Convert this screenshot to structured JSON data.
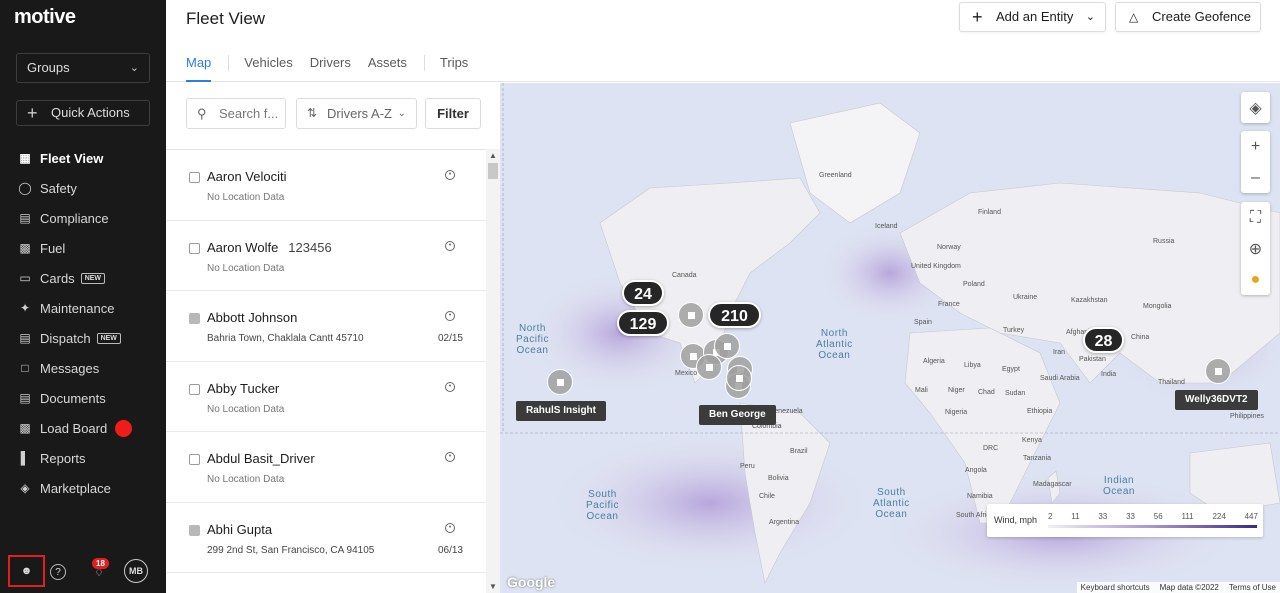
{
  "sidebar": {
    "logo": "motive",
    "groups_label": "Groups",
    "quick_actions_label": "Quick Actions",
    "items": [
      {
        "label": "Fleet View",
        "icon": "map-icon",
        "active": true
      },
      {
        "label": "Safety",
        "icon": "shield-icon"
      },
      {
        "label": "Compliance",
        "icon": "document-icon"
      },
      {
        "label": "Fuel",
        "icon": "fuel-icon"
      },
      {
        "label": "Cards",
        "icon": "card-icon",
        "badge": "NEW"
      },
      {
        "label": "Maintenance",
        "icon": "wrench-icon"
      },
      {
        "label": "Dispatch",
        "icon": "dispatch-icon",
        "badge": "NEW"
      },
      {
        "label": "Messages",
        "icon": "message-icon"
      },
      {
        "label": "Documents",
        "icon": "documents-icon"
      },
      {
        "label": "Load Board",
        "icon": "truck-icon",
        "dot_color": "#ef1c1c"
      },
      {
        "label": "Reports",
        "icon": "reports-icon"
      },
      {
        "label": "Marketplace",
        "icon": "marketplace-icon"
      }
    ],
    "notification_count": "18",
    "avatar_initials": "MB"
  },
  "header": {
    "title": "Fleet View",
    "add_entity_label": "Add an Entity",
    "create_geofence_label": "Create Geofence",
    "tabs": [
      {
        "label": "Map",
        "active": true
      },
      {
        "label": "Vehicles"
      },
      {
        "label": "Drivers"
      },
      {
        "label": "Assets"
      },
      {
        "label": "Trips"
      }
    ]
  },
  "list": {
    "search_placeholder": "Search f...",
    "sort_label": "Drivers A-Z",
    "filter_label": "Filter",
    "drivers": [
      {
        "name": "Aaron Velociti",
        "vehicle": "",
        "location": "No Location Data",
        "date": "",
        "status": "empty"
      },
      {
        "name": "Aaron Wolfe",
        "vehicle": "123456",
        "location": "No Location Data",
        "date": "",
        "status": "empty"
      },
      {
        "name": "Abbott Johnson",
        "vehicle": "",
        "location": "Bahria Town, Chaklala Cantt 45710",
        "date": "02/15",
        "status": "filled"
      },
      {
        "name": "Abby Tucker",
        "vehicle": "",
        "location": "No Location Data",
        "date": "",
        "status": "empty"
      },
      {
        "name": "Abdul Basit_Driver",
        "vehicle": "",
        "location": "No Location Data",
        "date": "",
        "status": "empty"
      },
      {
        "name": "Abhi Gupta",
        "vehicle": "",
        "location": "299 2nd St, San Francisco, CA 94105",
        "date": "06/13",
        "status": "filled"
      }
    ]
  },
  "map": {
    "clusters": [
      "24",
      "129",
      "210",
      "28"
    ],
    "tags": [
      "RahulS Insight",
      "Ben George",
      "Welly36DVT2"
    ],
    "oceans": [
      "North\nPacific\nOcean",
      "North\nAtlantic\nOcean",
      "South\nPacific\nOcean",
      "South\nAtlantic\nOcean",
      "Indian\nOcean"
    ],
    "places": [
      "Greenland",
      "Iceland",
      "Norway",
      "Finland",
      "Russia",
      "Canada",
      "United Kingdom",
      "Poland",
      "Ukraine",
      "Kazakhstan",
      "Mongolia",
      "France",
      "Spain",
      "Turkey",
      "Iran",
      "China",
      "Afghanistan",
      "Pakistan",
      "Algeria",
      "Libya",
      "Egypt",
      "Saudi Arabia",
      "Mali",
      "Niger",
      "Chad",
      "Sudan",
      "Nigeria",
      "Ethiopia",
      "Kenya",
      "DRC",
      "Tanzania",
      "Angola",
      "Namibia",
      "South Africa",
      "Madagascar",
      "India",
      "Thailand",
      "Mexico",
      "Venezuela",
      "Colombia",
      "Peru",
      "Brazil",
      "Bolivia",
      "Chile",
      "Argentina",
      "Philippines"
    ],
    "legend_title": "Wind, mph",
    "legend_values": [
      "2",
      "11",
      "33",
      "33",
      "56",
      "111",
      "224",
      "447"
    ],
    "google_label": "Google",
    "attribution": [
      "Keyboard shortcuts",
      "Map data ©2022",
      "Terms of Use"
    ]
  }
}
